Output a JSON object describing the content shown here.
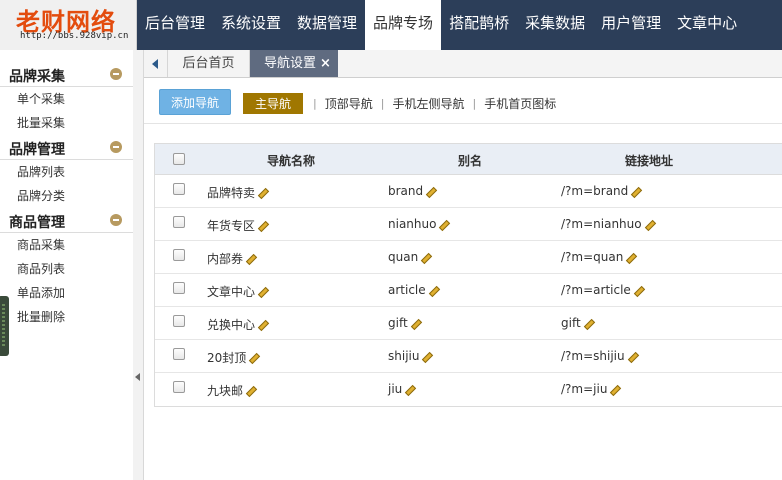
{
  "logo": {
    "title": "老财网络",
    "url": "http://bbs.928vip.cn"
  },
  "nav": {
    "items": [
      {
        "label": "后台管理",
        "active": false
      },
      {
        "label": "系统设置",
        "active": false
      },
      {
        "label": "数据管理",
        "active": false
      },
      {
        "label": "品牌专场",
        "active": true
      },
      {
        "label": "搭配鹊桥",
        "active": false
      },
      {
        "label": "采集数据",
        "active": false
      },
      {
        "label": "用户管理",
        "active": false
      },
      {
        "label": "文章中心",
        "active": false
      }
    ]
  },
  "sidebar": {
    "groups": [
      {
        "title": "品牌采集",
        "items": [
          "单个采集",
          "批量采集"
        ]
      },
      {
        "title": "品牌管理",
        "items": [
          "品牌列表",
          "品牌分类"
        ]
      },
      {
        "title": "商品管理",
        "items": [
          "商品采集",
          "商品列表",
          "单品添加",
          "批量删除"
        ]
      }
    ]
  },
  "tabs": {
    "home": "后台首页",
    "active": "导航设置",
    "close": "×"
  },
  "toolbar": {
    "add_label": "添加导航",
    "filters": [
      "主导航",
      "顶部导航",
      "手机左侧导航",
      "手机首页图标"
    ],
    "filter_sep": "|"
  },
  "table": {
    "headers": [
      "导航名称",
      "别名",
      "链接地址"
    ],
    "rows": [
      {
        "name": "品牌特卖",
        "alias": "brand",
        "link": "/?m=brand"
      },
      {
        "name": "年货专区",
        "alias": "nianhuo",
        "link": "/?m=nianhuo"
      },
      {
        "name": "内部券",
        "alias": "quan",
        "link": "/?m=quan"
      },
      {
        "name": "文章中心",
        "alias": "article",
        "link": "/?m=article"
      },
      {
        "name": "兑换中心",
        "alias": "gift",
        "link": "gift"
      },
      {
        "name": "20封顶",
        "alias": "shijiu",
        "link": "/?m=shijiu"
      },
      {
        "name": "九块邮",
        "alias": "jiu",
        "link": "/?m=jiu"
      }
    ]
  },
  "colors": {
    "topbar": "#2c3e59",
    "logo_text": "#e34c0e",
    "add_button": "#6fb2e4",
    "active_filter": "#a07700",
    "active_tab": "#5f6b80",
    "group_toggle": "#b79a60"
  }
}
